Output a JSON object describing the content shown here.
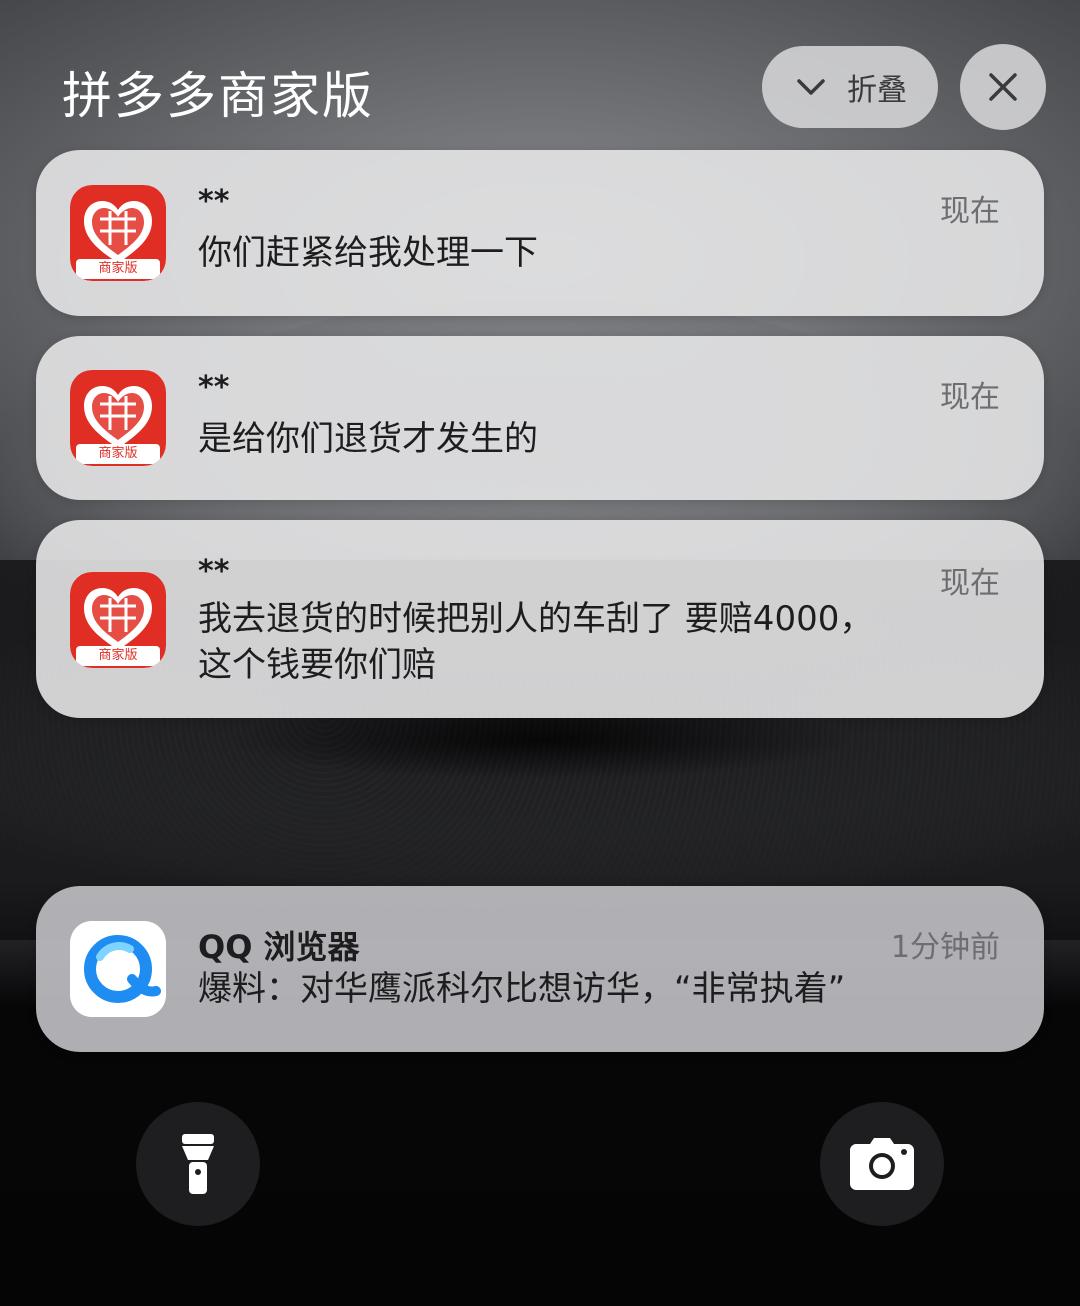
{
  "group": {
    "title": "拼多多商家版",
    "collapse_label": "折叠",
    "collapse_icon": "chevron-down-icon",
    "close_icon": "close-icon"
  },
  "notifications": [
    {
      "app_icon": "pinduoduo-merchant-icon",
      "icon_badge": "商家版",
      "sender": "**",
      "time": "现在",
      "message": "你们赶紧给我处理一下"
    },
    {
      "app_icon": "pinduoduo-merchant-icon",
      "icon_badge": "商家版",
      "sender": "**",
      "time": "现在",
      "message": "是给你们退货才发生的"
    },
    {
      "app_icon": "pinduoduo-merchant-icon",
      "icon_badge": "商家版",
      "sender": "**",
      "time": "现在",
      "message_line1": "我去退货的时候把别人的车刮了 要赔4000，",
      "message_line2": "这个钱要你们赔"
    }
  ],
  "qq_notification": {
    "app_icon": "qq-browser-icon",
    "app_name": "QQ 浏览器",
    "time": "1分钟前",
    "message": "爆料：对华鹰派科尔比想访华，“非常执着”"
  },
  "shortcuts": {
    "left_icon": "flashlight-icon",
    "right_icon": "camera-icon"
  },
  "colors": {
    "pdd_red": "#e02e24",
    "qq_blue": "#1e8cf0"
  }
}
